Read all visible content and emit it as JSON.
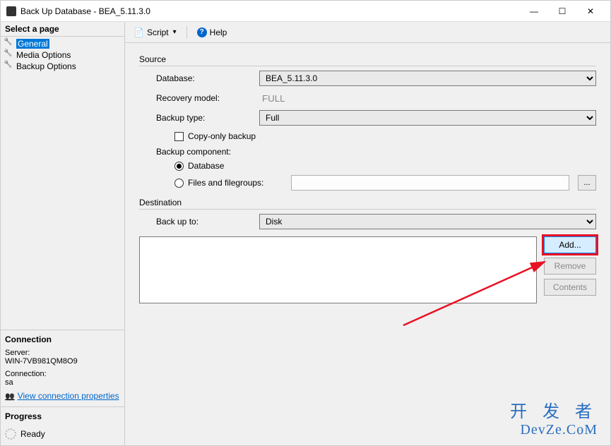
{
  "window": {
    "title": "Back Up Database - BEA_5.11.3.0"
  },
  "sidebar": {
    "pages_header": "Select a page",
    "pages": [
      {
        "label": "General",
        "selected": true
      },
      {
        "label": "Media Options",
        "selected": false
      },
      {
        "label": "Backup Options",
        "selected": false
      }
    ],
    "connection": {
      "header": "Connection",
      "server_label": "Server:",
      "server_value": "WIN-7VB981QM8O9",
      "conn_label": "Connection:",
      "conn_value": "sa",
      "view_props": "View connection properties"
    },
    "progress": {
      "header": "Progress",
      "status": "Ready"
    }
  },
  "toolbar": {
    "script": "Script",
    "help": "Help"
  },
  "source": {
    "group": "Source",
    "database_label": "Database:",
    "database_value": "BEA_5.11.3.0",
    "recovery_label": "Recovery model:",
    "recovery_value": "FULL",
    "backup_type_label": "Backup type:",
    "backup_type_value": "Full",
    "copy_only_label": "Copy-only backup",
    "component_label": "Backup component:",
    "radio_database": "Database",
    "radio_files": "Files and filegroups:"
  },
  "destination": {
    "group": "Destination",
    "backup_to_label": "Back up to:",
    "backup_to_value": "Disk",
    "add": "Add...",
    "remove": "Remove",
    "contents": "Contents"
  },
  "watermark": {
    "line1": "开 发 者",
    "line2": "DevZe.CoM"
  }
}
